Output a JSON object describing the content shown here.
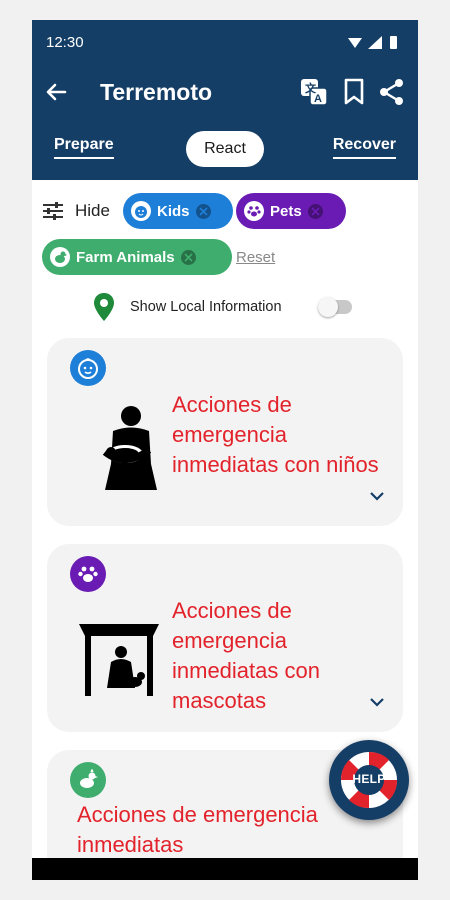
{
  "status_bar": {
    "time": "12:30"
  },
  "header": {
    "title": "Terremoto",
    "back_icon": "arrow-left-icon",
    "translate_icon": "translate-icon",
    "bookmark_icon": "bookmark-icon",
    "share_icon": "share-icon",
    "background_color": "#153e66"
  },
  "tabs": [
    {
      "label": "Prepare",
      "selected": false
    },
    {
      "label": "React",
      "selected": true
    },
    {
      "label": "Recover",
      "selected": false
    }
  ],
  "filters": {
    "hide_label": "Hide",
    "chips": [
      {
        "label": "Kids",
        "icon": "baby-face-icon",
        "color": "#1e7fd8"
      },
      {
        "label": "Pets",
        "icon": "paw-icon",
        "color": "#6a1bb4"
      },
      {
        "label": "Farm Animals",
        "icon": "chicken-icon",
        "color": "#3ead6d"
      }
    ],
    "reset_label": "Reset"
  },
  "local_info": {
    "label": "Show Local Information",
    "enabled": false
  },
  "cards": [
    {
      "title": "Acciones de emergencia inmediatas con niños",
      "badge_icon": "baby-face-icon",
      "illustration": "person-holding-baby-icon"
    },
    {
      "title": "Acciones de emergencia inmediatas con mascotas",
      "badge_icon": "paw-icon",
      "illustration": "person-under-table-with-pet-icon"
    },
    {
      "title": "Acciones de emergencia inmediatas",
      "badge_icon": "chicken-icon"
    }
  ],
  "help_button": {
    "label": "HELP",
    "icon": "lifebuoy-icon"
  },
  "colors": {
    "accent_red": "#e3232b",
    "navy": "#153e66"
  }
}
